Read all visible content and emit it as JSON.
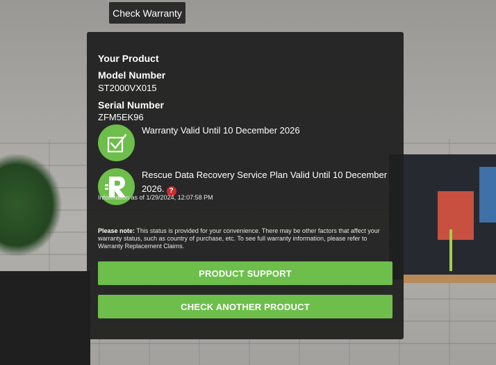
{
  "top_tab": {
    "label": "Check Warranty"
  },
  "product": {
    "heading": "Your Product",
    "model_label": "Model Number",
    "model_value": "ST2000VX015",
    "serial_label": "Serial Number",
    "serial_value": "ZFM5EK96"
  },
  "warranty": {
    "text": "Warranty Valid Until 10 December 2026",
    "icon": "checkbox-check-icon"
  },
  "rescue": {
    "text": "Rescue Data Recovery Service Plan Valid Until 10 December 2026.",
    "icon": "rescue-r-icon",
    "help": "?"
  },
  "info_time": "Information as of 1/29/2024, 12:07:58 PM",
  "note": {
    "label": "Please note:",
    "text": " This status is provided for your convenience. There may be other factors that affect your warranty status, such as country of purchase, etc. To see full warranty information, please refer to Warranty Replacement Claims."
  },
  "buttons": {
    "support": "PRODUCT SUPPORT",
    "check_another": "CHECK ANOTHER PRODUCT"
  },
  "colors": {
    "accent": "#6dbe4b",
    "panel": "#1e1e1e",
    "help": "#d02a2a"
  }
}
